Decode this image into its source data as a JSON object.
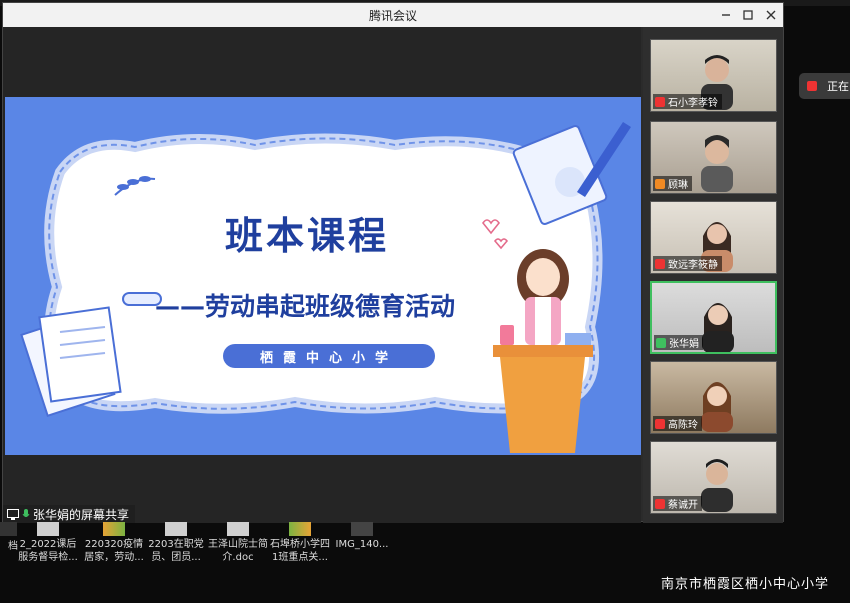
{
  "window": {
    "title": "腾讯会议"
  },
  "slide": {
    "title": "班本课程",
    "subtitle": "——劳动串起班级德育活动",
    "school": "栖霞中心小学"
  },
  "share": {
    "label": "张华娟的屏幕共享"
  },
  "participants": [
    {
      "name": "石小李孝铃",
      "mic": "muted"
    },
    {
      "name": "顾琳",
      "mic": "user"
    },
    {
      "name": "致远李筱静",
      "mic": "muted"
    },
    {
      "name": "张华娟",
      "mic": "on"
    },
    {
      "name": "高陈玲",
      "mic": "muted"
    },
    {
      "name": "蔡诚开",
      "mic": "muted"
    }
  ],
  "pill": {
    "label": "正在"
  },
  "files": [
    {
      "label_1": "档",
      "label_2": ""
    },
    {
      "label_1": "2_2022课后",
      "label_2": "服务督导检..."
    },
    {
      "label_1": "220320疫情",
      "label_2": "居家，劳动..."
    },
    {
      "label_1": "2203在职党",
      "label_2": "员、团员..."
    },
    {
      "label_1": "王泽山院士简",
      "label_2": "介.doc"
    },
    {
      "label_1": "石埠桥小学四",
      "label_2": "1班重点关..."
    },
    {
      "label_1": "IMG_140...",
      "label_2": ""
    }
  ],
  "watermark": "南京市栖霞区栖小中心小学"
}
